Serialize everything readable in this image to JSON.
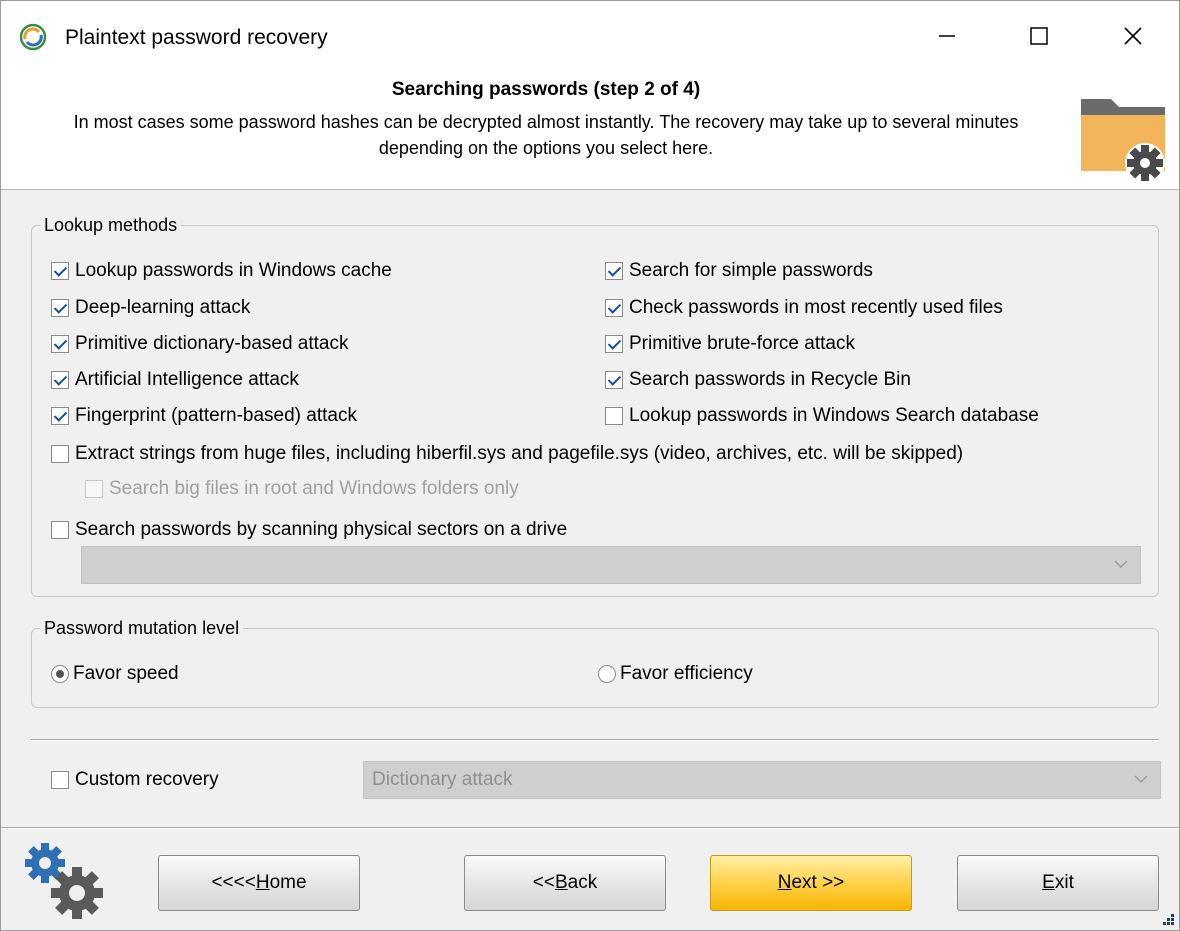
{
  "window": {
    "title": "Plaintext password recovery",
    "controls": {
      "minimize": "—",
      "maximize": "☐",
      "close": "✕"
    }
  },
  "header": {
    "title": "Searching passwords (step 2 of 4)",
    "description": "In most cases some password hashes can be decrypted almost instantly. The recovery may take up to several minutes depending on the options you select here.",
    "icon": "folder-gear-icon"
  },
  "lookup_methods": {
    "legend": "Lookup methods",
    "left": [
      {
        "label": "Lookup passwords in Windows cache",
        "checked": true
      },
      {
        "label": "Deep-learning attack",
        "checked": true
      },
      {
        "label": "Primitive dictionary-based attack",
        "checked": true
      },
      {
        "label": "Artificial Intelligence attack",
        "checked": true
      },
      {
        "label": "Fingerprint (pattern-based) attack",
        "checked": true
      }
    ],
    "right": [
      {
        "label": "Search for simple passwords",
        "checked": true
      },
      {
        "label": "Check passwords in most recently used files",
        "checked": true
      },
      {
        "label": "Primitive brute-force attack",
        "checked": true
      },
      {
        "label": "Search passwords in Recycle Bin",
        "checked": true
      },
      {
        "label": "Lookup passwords in Windows Search database",
        "checked": false
      }
    ],
    "extract_strings": {
      "label": "Extract strings from huge files, including hiberfil.sys and pagefile.sys (video, archives, etc. will be skipped)",
      "checked": false
    },
    "search_big_files": {
      "label": "Search big files in root and Windows folders only",
      "checked": false,
      "disabled": true
    },
    "scan_sectors": {
      "label": "Search passwords by scanning physical sectors on a drive",
      "checked": false
    },
    "drive_select": {
      "value": ""
    }
  },
  "mutation": {
    "legend": "Password mutation level",
    "options": [
      {
        "label": "Favor speed",
        "selected": true
      },
      {
        "label": "Favor efficiency",
        "selected": false
      }
    ]
  },
  "custom_recovery": {
    "label": "Custom recovery",
    "checked": false,
    "select_value": "Dictionary attack"
  },
  "buttons": {
    "home": {
      "prefix": "<<<< ",
      "mnemonic": "H",
      "rest": "ome"
    },
    "back": {
      "prefix": "<< ",
      "mnemonic": "B",
      "rest": "ack"
    },
    "next": {
      "prefix": "",
      "mnemonic": "N",
      "rest": "ext >>"
    },
    "exit": {
      "prefix": "",
      "mnemonic": "E",
      "rest": "xit"
    }
  },
  "colors": {
    "accent_button": "#ffd24a",
    "checkmark": "#1a4f9c",
    "folder": "#f2b55a"
  }
}
